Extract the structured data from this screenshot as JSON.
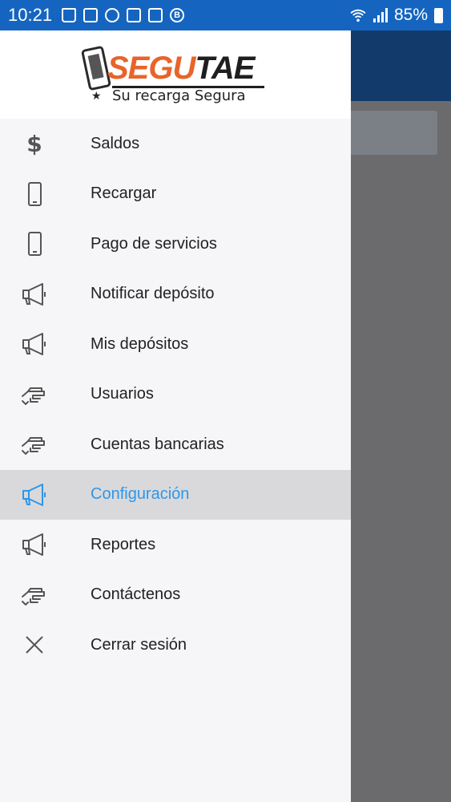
{
  "status_bar": {
    "time": "10:21",
    "battery_text": "85%",
    "icons": [
      "shopping-bag-icon",
      "phone-vibrate-icon",
      "figure-icon",
      "image-icon",
      "flipboard-icon",
      "b-badge-icon",
      "wifi-icon",
      "signal-icon",
      "battery-icon"
    ]
  },
  "drawer": {
    "logo": {
      "word_part1": "SEGU",
      "word_part2": "TAE",
      "tagline": "Su recarga Segura"
    },
    "items": [
      {
        "label": "Saldos",
        "icon": "dollar-icon"
      },
      {
        "label": "Recargar",
        "icon": "phone-icon"
      },
      {
        "label": "Pago de servicios",
        "icon": "phone-icon"
      },
      {
        "label": "Notificar depósito",
        "icon": "megaphone-icon"
      },
      {
        "label": "Mis depósitos",
        "icon": "megaphone-icon"
      },
      {
        "label": "Usuarios",
        "icon": "hand-icon"
      },
      {
        "label": "Cuentas bancarias",
        "icon": "hand-icon"
      },
      {
        "label": "Configuración",
        "icon": "megaphone-icon",
        "active": true
      },
      {
        "label": "Reportes",
        "icon": "megaphone-icon"
      },
      {
        "label": "Contáctenos",
        "icon": "hand-icon"
      },
      {
        "label": "Cerrar sesión",
        "icon": "close-icon"
      }
    ]
  },
  "colors": {
    "status_bar": "#1565c0",
    "accent": "#2f96e8",
    "logo_orange": "#e8642a",
    "active_bg": "#d9d9db"
  }
}
